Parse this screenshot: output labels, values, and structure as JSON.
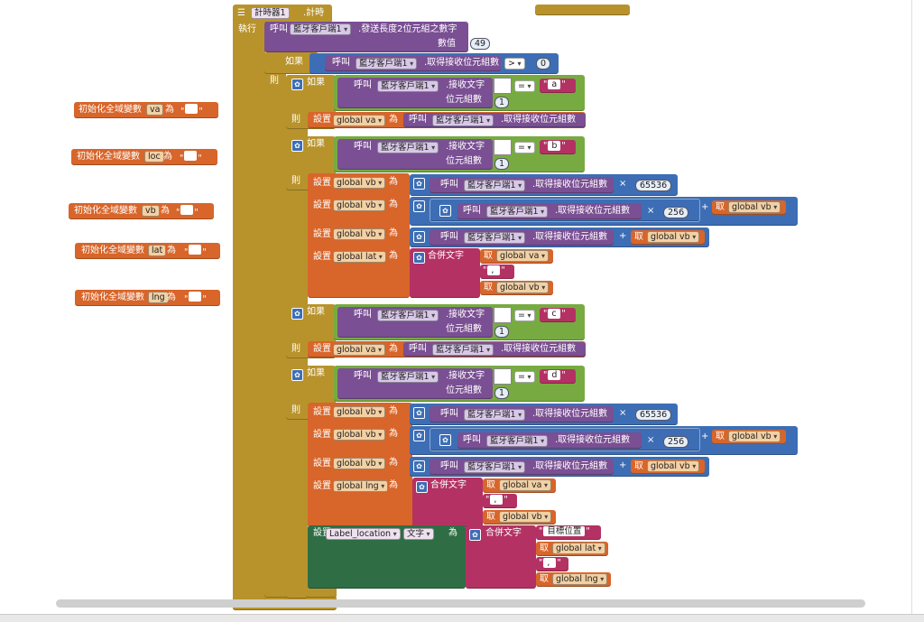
{
  "globals": [
    {
      "init_label": "初始化全域變數",
      "var": "va",
      "as": "為"
    },
    {
      "init_label": "初始化全域變數",
      "var": "loc",
      "as": "為"
    },
    {
      "init_label": "初始化全域變數",
      "var": "vb",
      "as": "為"
    },
    {
      "init_label": "初始化全域變數",
      "var": "lat",
      "as": "為"
    },
    {
      "init_label": "初始化全域變數",
      "var": "lng",
      "as": "為"
    }
  ],
  "event": {
    "component": "計時器1",
    "event": ".計時",
    "do_label": "執行",
    "call_word": "呼叫",
    "bt": "藍牙客戶端1",
    "send_method": ".發送長度2位元組之數字",
    "number_label": "數值",
    "number_value": "49"
  },
  "labels": {
    "if": "如果",
    "then": "則",
    "set": "設置",
    "as": "為",
    "get": "取",
    "receive_text": ".接收文字",
    "byte_count": "位元組數",
    "bytes_available": ".取得接收位元組數",
    "join": "合併文字",
    "eq": "=",
    "gt": ">",
    "plus": "+",
    "times": "×"
  },
  "values": {
    "zero": "0",
    "one": "1",
    "n65536": "65536",
    "n256": "256",
    "a": "a",
    "b": "b",
    "c": "c",
    "d": "d",
    "comma": ",",
    "target": "目標位置"
  },
  "vars": {
    "gva": "global va",
    "gvb": "global vb",
    "glat": "global lat",
    "glng": "global lng",
    "label_location": "Label_location",
    "text_prop": "文字"
  },
  "colors": {
    "event": "#b8932c",
    "procedure": "#7a4f93",
    "control": "#b8932c",
    "logic": "#77ab41",
    "math": "#3d6eb5",
    "text": "#b33263",
    "variable": "#d8652a",
    "component": "#2f6e45"
  }
}
